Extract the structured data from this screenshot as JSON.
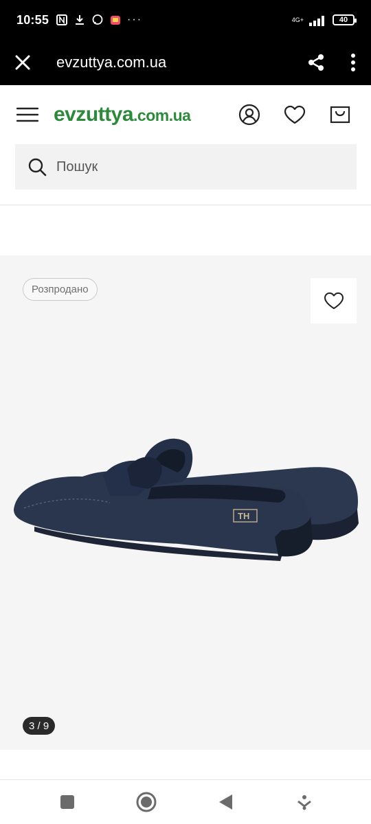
{
  "status_bar": {
    "time": "10:55",
    "network": "4G+",
    "battery": "40"
  },
  "browser": {
    "url": "evzuttya.com.ua",
    "icons": [
      "close-icon",
      "share-icon",
      "more-vertical-icon"
    ]
  },
  "site": {
    "logo_main": "evzuttya",
    "logo_tld": ".com.ua",
    "brand_color": "#2d8a3a",
    "icons": [
      "menu-icon",
      "account-icon",
      "heart-icon",
      "bag-icon"
    ]
  },
  "search": {
    "placeholder": "Пошук"
  },
  "product": {
    "badge": "Розпродано",
    "image_counter": "3 / 9",
    "shoe_color": "#26344a",
    "logo_text": "TH"
  },
  "nav": {
    "icons": [
      "recents-square-icon",
      "home-circle-icon",
      "back-triangle-icon",
      "assistant-icon"
    ]
  }
}
